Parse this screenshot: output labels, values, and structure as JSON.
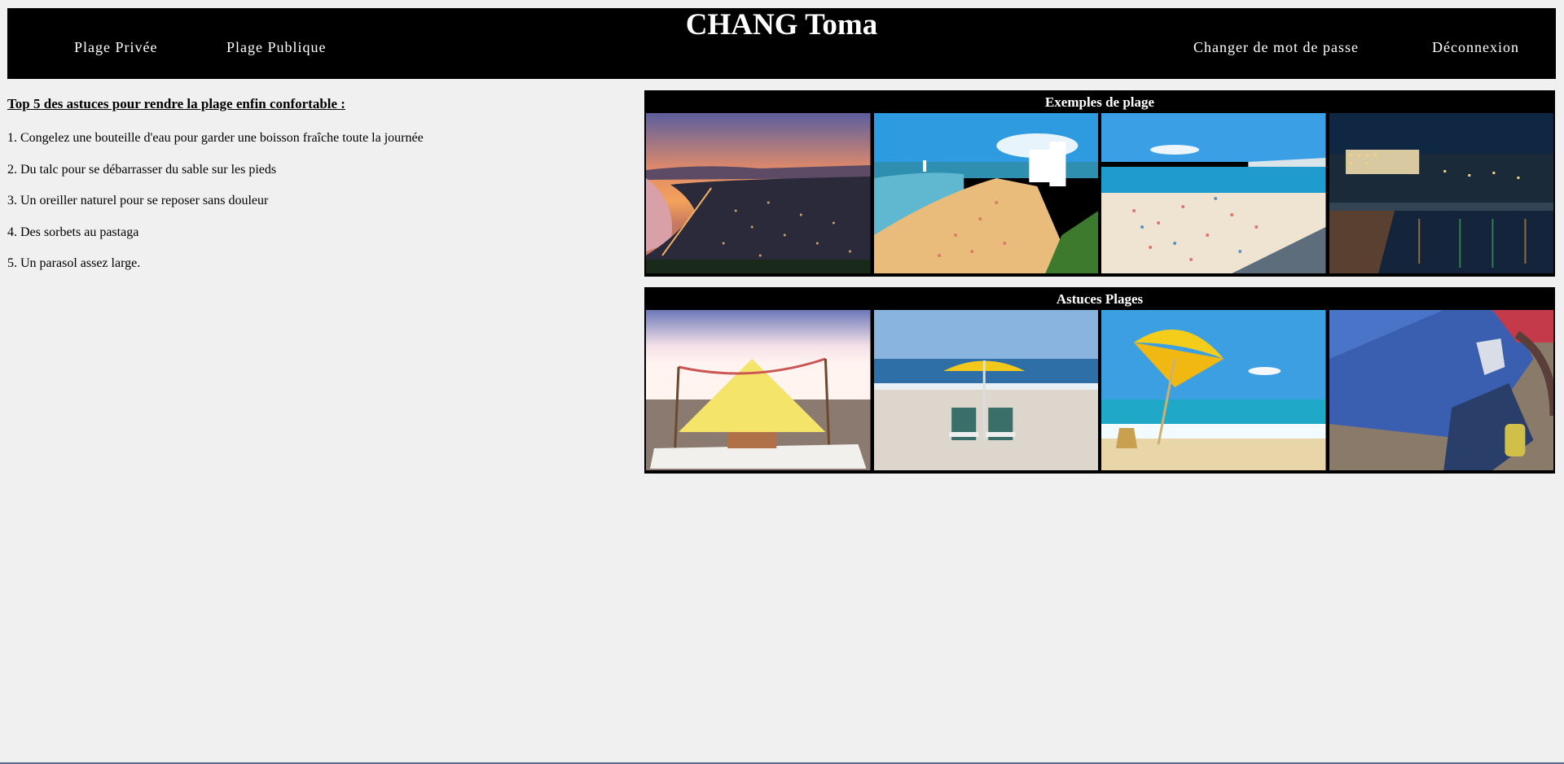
{
  "header": {
    "title": "CHANG Toma",
    "nav_left": [
      "Plage Privée",
      "Plage Publique"
    ],
    "nav_right": [
      "Changer de mot de passe",
      "Déconnexion"
    ]
  },
  "tips": {
    "title": "Top 5 des astuces pour rendre la plage enfin confortable :",
    "items": [
      "1. Congelez une bouteille d'eau pour garder une boisson fraîche toute la journée",
      "2. Du talc pour se débarrasser du sable sur les pieds",
      "3. Un oreiller naturel pour se reposer sans douleur",
      "4. Des sorbets au pastaga",
      "5. Un parasol assez large."
    ]
  },
  "galleries": {
    "examples": {
      "title": "Exemples de plage",
      "images": [
        "sunset-coastline-photo",
        "beach-resort-photo",
        "crowded-beach-photo",
        "night-promenade-photo"
      ]
    },
    "tips": {
      "title": "Astuces Plages",
      "images": [
        "beach-tent-photo",
        "umbrella-chairs-photo",
        "yellow-parasol-photo",
        "beach-towel-bag-photo"
      ]
    }
  },
  "colors": {
    "header_bg": "#000000",
    "page_bg": "#f0f0f0",
    "text": "#000000"
  }
}
